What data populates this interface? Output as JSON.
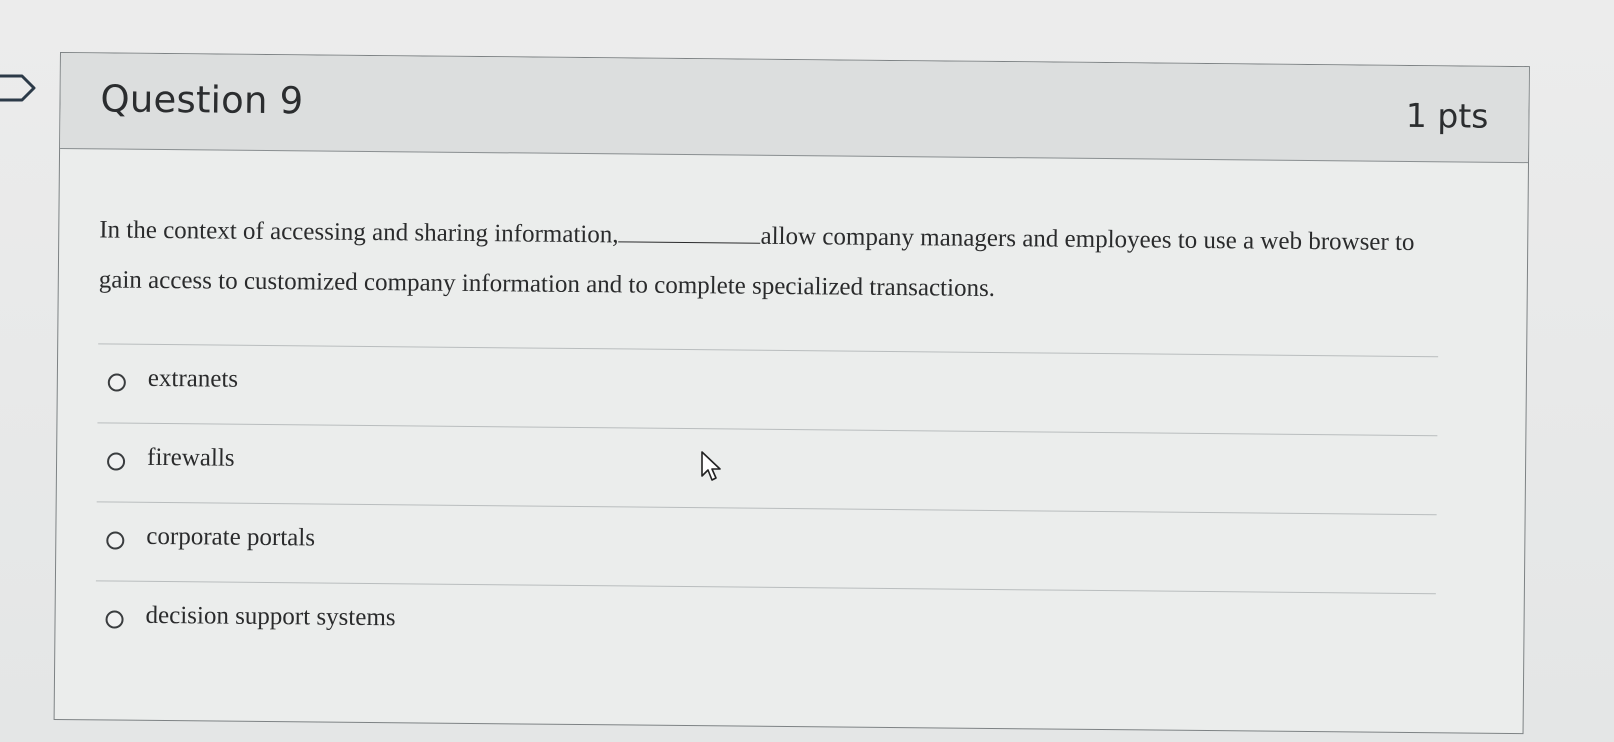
{
  "question": {
    "title": "Question 9",
    "points": "1 pts",
    "text_before_blank": "In the context of accessing and sharing information,",
    "text_after_blank": "allow company managers and employees to use a web browser to gain access to customized company information and to complete specialized transactions."
  },
  "answers": [
    {
      "label": "extranets",
      "selected": false
    },
    {
      "label": "firewalls",
      "selected": false
    },
    {
      "label": "corporate portals",
      "selected": false
    },
    {
      "label": "decision support systems",
      "selected": false
    }
  ],
  "icons": {
    "flag": "bookmark-flag-icon",
    "cursor": "mouse-pointer-icon"
  }
}
